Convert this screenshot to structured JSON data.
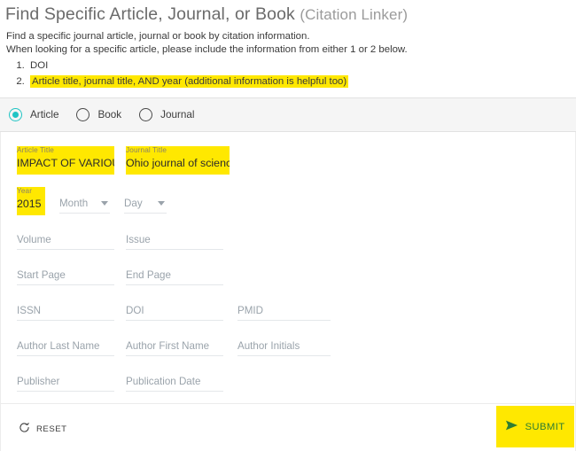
{
  "header": {
    "title_main": "Find Specific Article, Journal, or Book",
    "title_sub": "(Citation Linker)",
    "desc_line1": "Find a specific journal article, journal or book by citation information.",
    "desc_line2": "When looking for a specific article, please include the information from either 1 or 2 below.",
    "requirements": [
      {
        "text": "DOI",
        "highlighted": false
      },
      {
        "text": "Article title, journal title, AND year (additional information is helpful too)",
        "highlighted": true
      }
    ]
  },
  "type_selector": {
    "options": [
      {
        "label": "Article",
        "selected": true
      },
      {
        "label": "Book",
        "selected": false
      },
      {
        "label": "Journal",
        "selected": false
      }
    ],
    "accent_color": "#21c4c4"
  },
  "form": {
    "article_title": {
      "label": "Article Title",
      "value": "IMPACT OF VARIOUS CA",
      "filled": true
    },
    "journal_title": {
      "label": "Journal Title",
      "value": "Ohio journal of science",
      "filled": true
    },
    "year": {
      "label": "Year",
      "value": "2015",
      "filled": true
    },
    "month": {
      "placeholder": "Month",
      "value": ""
    },
    "day": {
      "placeholder": "Day",
      "value": ""
    },
    "volume": {
      "placeholder": "Volume",
      "value": ""
    },
    "issue": {
      "placeholder": "Issue",
      "value": ""
    },
    "start_page": {
      "placeholder": "Start Page",
      "value": ""
    },
    "end_page": {
      "placeholder": "End Page",
      "value": ""
    },
    "issn": {
      "placeholder": "ISSN",
      "value": ""
    },
    "doi": {
      "placeholder": "DOI",
      "value": ""
    },
    "pmid": {
      "placeholder": "PMID",
      "value": ""
    },
    "author_last_name": {
      "placeholder": "Author Last Name",
      "value": ""
    },
    "author_first_name": {
      "placeholder": "Author First Name",
      "value": ""
    },
    "author_initials": {
      "placeholder": "Author Initials",
      "value": ""
    },
    "publisher": {
      "placeholder": "Publisher",
      "value": ""
    },
    "publication_date": {
      "placeholder": "Publication Date",
      "value": ""
    }
  },
  "footer": {
    "reset_label": "RESET",
    "submit_label": "SUBMIT",
    "submit_bg": "#ffe800",
    "submit_text_color": "#2e7d32"
  },
  "highlight_color": "#ffe800"
}
